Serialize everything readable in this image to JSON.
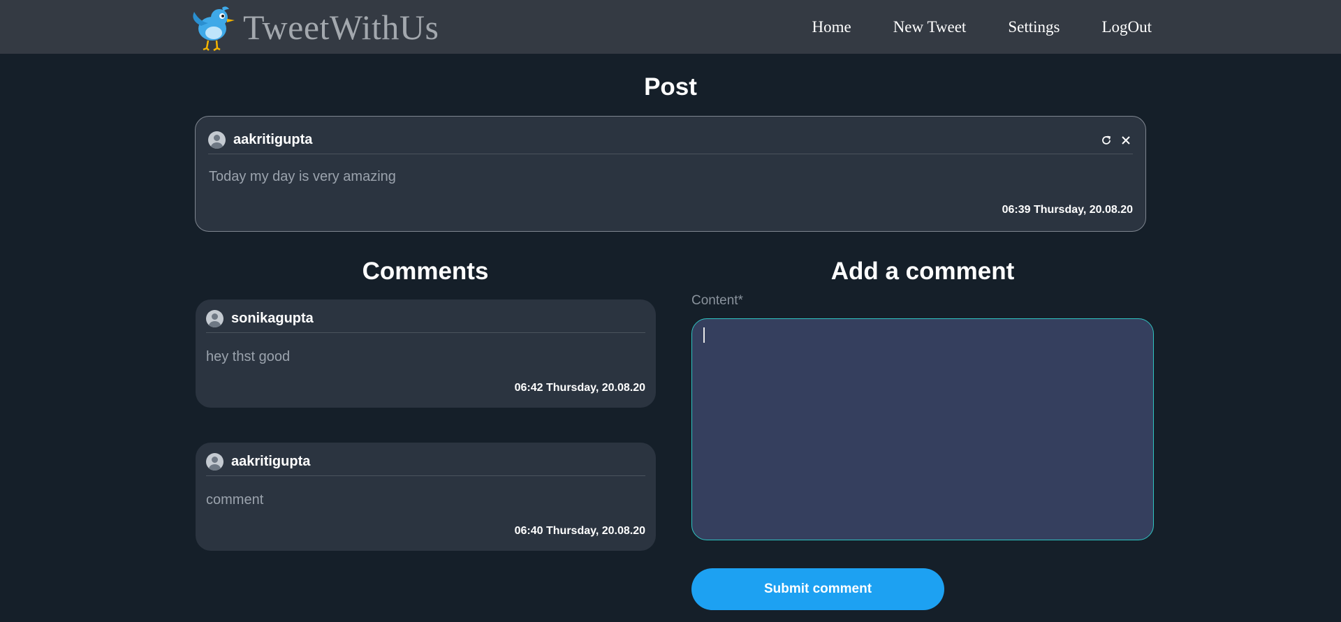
{
  "nav": {
    "brand": "TweetWithUs",
    "links": [
      "Home",
      "New Tweet",
      "Settings",
      "LogOut"
    ]
  },
  "post": {
    "heading": "Post",
    "username": "aakritigupta",
    "text": "Today my day is very amazing",
    "timestamp": "06:39 Thursday, 20.08.20"
  },
  "comments": {
    "heading": "Comments",
    "items": [
      {
        "username": "sonikagupta",
        "text": "hey thst good",
        "timestamp": "06:42 Thursday, 20.08.20"
      },
      {
        "username": "aakritigupta",
        "text": "comment",
        "timestamp": "06:40 Thursday, 20.08.20"
      }
    ]
  },
  "add_comment": {
    "heading": "Add a comment",
    "content_label": "Content*",
    "content_value": "",
    "submit_label": "Submit comment"
  },
  "colors": {
    "page_bg": "#151f29",
    "navbar_bg": "#343a43",
    "card_bg": "#2b3440",
    "accent": "#1da1f2",
    "focus_border": "#2fc4c2"
  },
  "icons": {
    "logo": "twitter-bird-icon",
    "avatar": "user-avatar-icon",
    "edit": "refresh-icon",
    "delete": "close-icon"
  }
}
